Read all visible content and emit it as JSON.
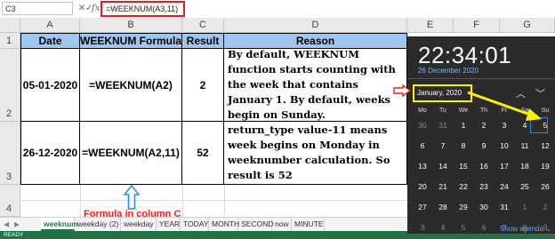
{
  "formula_bar": {
    "name_box": "C3",
    "cancel_icon": "✕",
    "enter_icon": "✓",
    "fx_label": "fx",
    "formula": "=WEEKNUM(A3,11)"
  },
  "columns": [
    "A",
    "B",
    "C",
    "D",
    "E",
    "F",
    "G"
  ],
  "rows": [
    "1",
    "2",
    "3",
    "4"
  ],
  "table": {
    "headers": [
      "Date",
      "WEEKNUM Formula",
      "Result",
      "Reason"
    ],
    "rows": [
      {
        "date": "05-01-2020",
        "formula": "=WEEKNUM(A2)",
        "result": "2",
        "reason": "By default, WEEKNUM function starts counting with the week that contains January 1. By default, weeks begin on Sunday."
      },
      {
        "date": "26-12-2020",
        "formula": "=WEEKNUM(A2,11)",
        "result": "52",
        "reason": "return_type value-11 means week begins on Monday in weeknumber calculation. So result is 52"
      }
    ]
  },
  "annotation": "Formula in column C",
  "sheet_tabs": [
    "weeknum",
    "weekday (2)",
    "weekday",
    "YEAR",
    "TODAY",
    "MONTH",
    "SECOND",
    "now",
    "MINUTE"
  ],
  "status": "READY",
  "calendar": {
    "time": "22:34:01",
    "date": "26 December 2020",
    "month": "January, 2020",
    "weekdays": [
      "Mo",
      "Tu",
      "We",
      "Th",
      "Fr",
      "Sa",
      "Su"
    ],
    "weeks": [
      [
        "30",
        "31",
        "1",
        "2",
        "3",
        "4",
        "5"
      ],
      [
        "6",
        "7",
        "8",
        "9",
        "10",
        "11",
        "12"
      ],
      [
        "13",
        "14",
        "15",
        "16",
        "17",
        "18",
        "19"
      ],
      [
        "20",
        "21",
        "22",
        "23",
        "24",
        "25",
        "26"
      ],
      [
        "27",
        "28",
        "29",
        "30",
        "31",
        "1",
        "2"
      ],
      [
        "3",
        "4",
        "5",
        "6",
        "7",
        "8",
        "9"
      ]
    ],
    "agenda_link": "Show agenda ⌄"
  },
  "colors": {
    "header_fill": "#9fc6ec",
    "annotation": "#ff1a1a",
    "highlight_box": "#ffef00",
    "excel_green": "#217346"
  }
}
